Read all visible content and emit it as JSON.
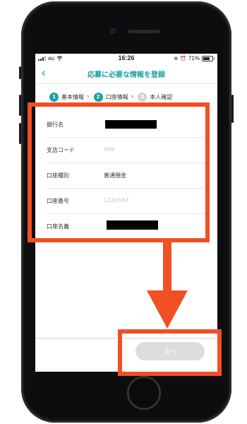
{
  "status_bar": {
    "carrier": "au",
    "time": "16:26",
    "battery": "71%"
  },
  "nav": {
    "back_icon": "chevron-left-icon",
    "title": "応募に必要な情報を登録"
  },
  "steps": [
    {
      "num": "1",
      "label": "基本情報",
      "state": "active"
    },
    {
      "num": "2",
      "label": "口座情報",
      "state": "active"
    },
    {
      "num": "3",
      "label": "本人確認",
      "state": "inactive"
    }
  ],
  "form": {
    "bank_name": {
      "label": "銀行名",
      "value": ""
    },
    "branch_code": {
      "label": "支店コード",
      "placeholder": "999"
    },
    "account_type": {
      "label": "口座種別",
      "value": "普通預金"
    },
    "account_number": {
      "label": "口座番号",
      "placeholder": "1234567"
    },
    "account_holder": {
      "label": "口座名義",
      "value": ""
    }
  },
  "next_button": {
    "label": "次へ",
    "disabled": true
  },
  "colors": {
    "accent": "#1aa3a3",
    "highlight": "#f05023",
    "disabled_button": "#dcdde1"
  }
}
